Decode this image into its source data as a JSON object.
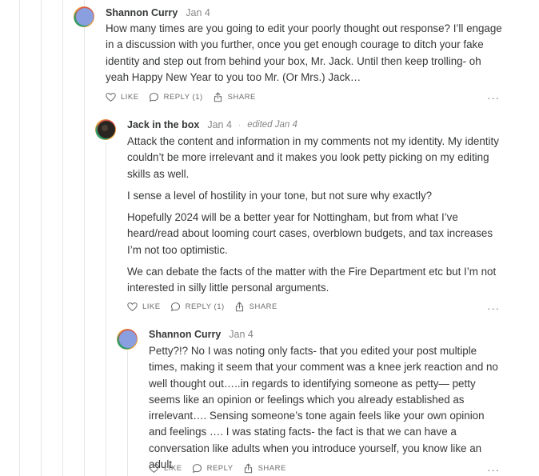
{
  "comments": [
    {
      "author": "Shannon Curry",
      "date": "Jan 4",
      "paragraphs": [
        "How many times are you going to edit your poorly thought out response? I’ll engage in a discussion with you further, once you get enough courage to ditch your fake identity and step out from behind your box, Mr. Jack. Until then keep trolling- oh yeah Happy New Year to you too Mr. (Or Mrs.) Jack…"
      ],
      "actions": {
        "like": "LIKE",
        "reply": "REPLY (1)",
        "share": "SHARE"
      },
      "more": "···"
    },
    {
      "author": "Jack in the box",
      "date": "Jan 4",
      "separator": "·",
      "edited": "edited Jan 4",
      "paragraphs": [
        "Attack the content and information in my comments not my identity. My identity couldn’t be more irrelevant and it makes you look petty picking on my editing skills as well.",
        "I sense a level of hostility in your tone, but not sure why exactly?",
        "Hopefully 2024 will be a better year for Nottingham, but from what I’ve heard/read about looming court cases, overblown budgets, and tax increases I’m not too optimistic.",
        "We can debate the facts of the matter with the Fire Department etc but I’m not interested in silly little personal arguments."
      ],
      "actions": {
        "like": "LIKE",
        "reply": "REPLY (1)",
        "share": "SHARE"
      },
      "more": "···"
    },
    {
      "author": "Shannon Curry",
      "date": "Jan 4",
      "paragraphs": [
        "Petty?!? No I was noting only facts- that you edited your post multiple times, making it seem that your comment was a knee jerk reaction and no well thought out…..in regards to identifying someone as petty— petty seems like an opinion or feelings which you already established as irrelevant…. Sensing someone’s tone again feels like your own opinion and feelings …. I was stating facts- the fact is that we can have a conversation like adults when you introduce yourself, you know like an adult."
      ],
      "actions": {
        "like": "LIKE",
        "reply": "REPLY",
        "share": "SHARE"
      },
      "more": "···"
    }
  ],
  "colors": {
    "text": "#363737",
    "muted": "#868787",
    "thread_line": "#e6e6e6",
    "avatar_orange": "#f0a23a",
    "avatar_green": "#2e9e6a",
    "avatar_red": "#d9574a",
    "avatar_blue": "#8a9fe0",
    "avatar_dark": "#2a2520"
  }
}
